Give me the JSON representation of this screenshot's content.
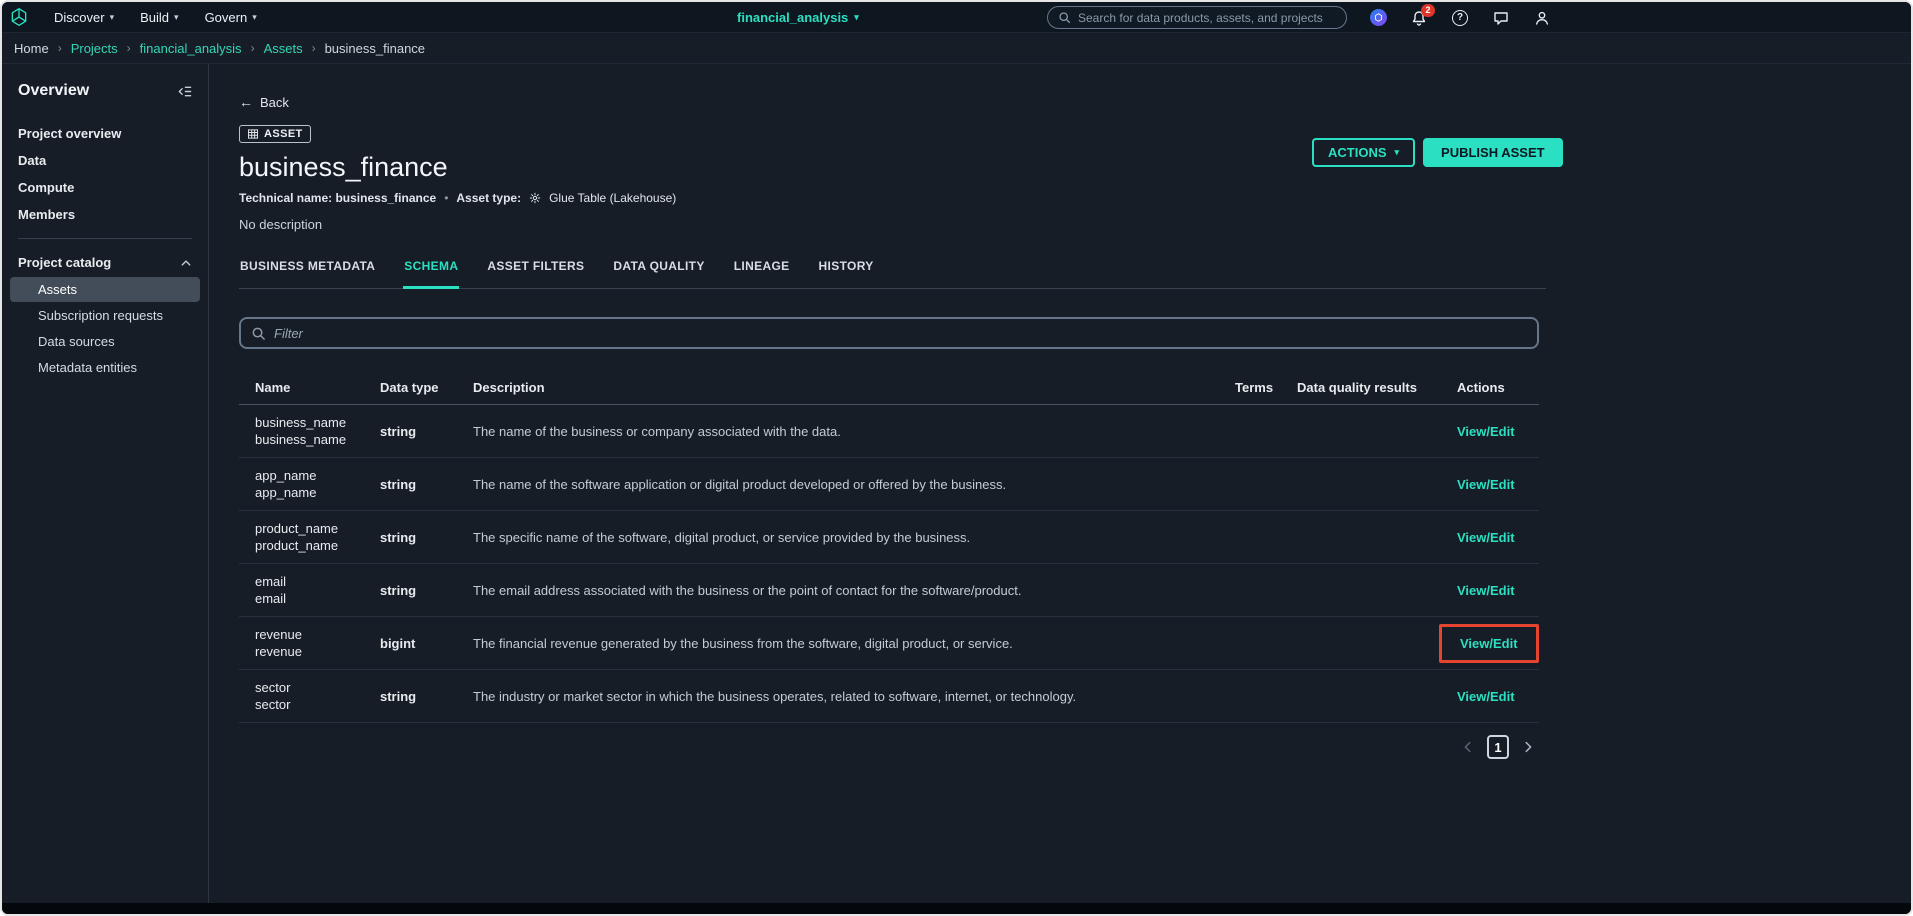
{
  "colors": {
    "accent": "#2be0c2",
    "annotation_box": "#e5452f",
    "selected_sidebar_bg": "#434c59",
    "notification_badge": "#e0352b",
    "background": "#161d26"
  },
  "icons": {
    "caret_down": "▾",
    "caret_up": "▴",
    "breadcrumb_separator": "›",
    "back_arrow": "←",
    "bullet": "•",
    "help_glyph": "?"
  },
  "topnav": {
    "menus": [
      {
        "label": "Discover"
      },
      {
        "label": "Build"
      },
      {
        "label": "Govern"
      }
    ],
    "project": "financial_analysis",
    "search_placeholder": "Search for data products, assets, and projects",
    "notification_count": "2"
  },
  "breadcrumb": {
    "items": [
      "Home",
      "Projects",
      "financial_analysis",
      "Assets",
      "business_finance"
    ]
  },
  "sidebar": {
    "title": "Overview",
    "items": [
      "Project overview",
      "Data",
      "Compute",
      "Members"
    ],
    "catalog": {
      "label": "Project catalog",
      "items": [
        "Assets",
        "Subscription requests",
        "Data sources",
        "Metadata entities"
      ],
      "selected": "Assets"
    }
  },
  "asset": {
    "back_label": "Back",
    "type_badge": "ASSET",
    "title": "business_finance",
    "technical_name": "Technical name: business_finance",
    "asset_type_label": "Asset type:",
    "asset_type_value": "Glue Table (Lakehouse)",
    "description": "No description",
    "actions_button": "ACTIONS",
    "publish_button": "PUBLISH ASSET"
  },
  "tabs": [
    {
      "label": "BUSINESS METADATA",
      "active": false
    },
    {
      "label": "SCHEMA",
      "active": true
    },
    {
      "label": "ASSET FILTERS",
      "active": false
    },
    {
      "label": "DATA QUALITY",
      "active": false
    },
    {
      "label": "LINEAGE",
      "active": false
    },
    {
      "label": "HISTORY",
      "active": false
    }
  ],
  "schema": {
    "filter_placeholder": "Filter",
    "columns": [
      "Name",
      "Data type",
      "Description",
      "Terms",
      "Data quality results",
      "Actions"
    ],
    "action_label": "View/Edit",
    "rows": [
      {
        "name": "business_name",
        "technical_name": "business_name",
        "type": "string",
        "description": "The name of the business or company associated with the data."
      },
      {
        "name": "app_name",
        "technical_name": "app_name",
        "type": "string",
        "description": "The name of the software application or digital product developed or offered by the business."
      },
      {
        "name": "product_name",
        "technical_name": "product_name",
        "type": "string",
        "description": "The specific name of the software, digital product, or service provided by the business."
      },
      {
        "name": "email",
        "technical_name": "email",
        "type": "string",
        "description": "The email address associated with the business or the point of contact for the software/product."
      },
      {
        "name": "revenue",
        "technical_name": "revenue",
        "type": "bigint",
        "description": "The financial revenue generated by the business from the software, digital product, or service."
      },
      {
        "name": "sector",
        "technical_name": "sector",
        "type": "string",
        "description": "The industry or market sector in which the business operates, related to software, internet, or technology."
      }
    ],
    "pagination": {
      "current_page": "1"
    }
  }
}
